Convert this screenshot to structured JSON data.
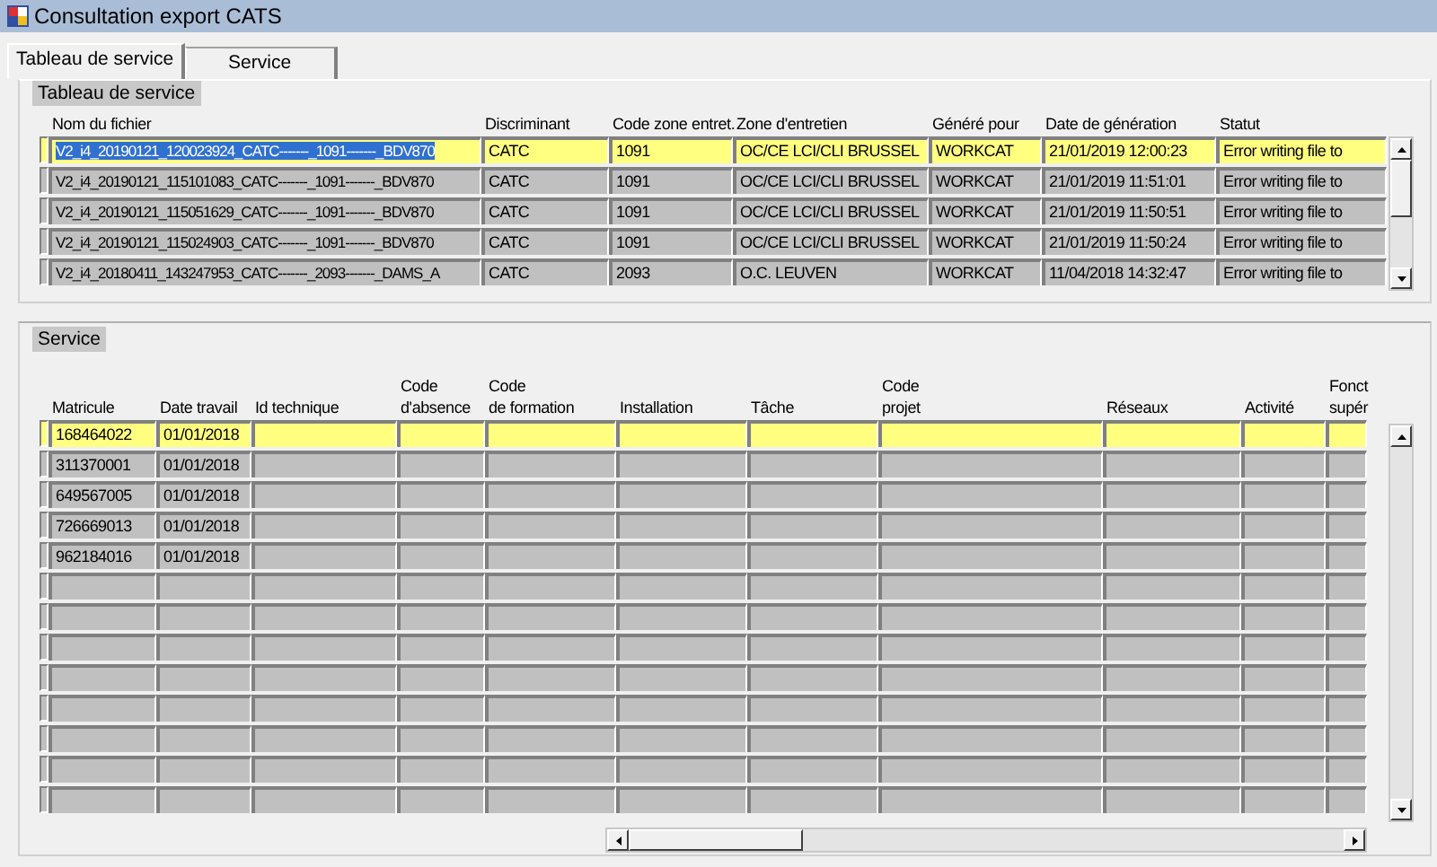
{
  "window": {
    "title": "Consultation export CATS"
  },
  "tabs": [
    {
      "label": "Tableau de service",
      "selected": true
    },
    {
      "label": "Service",
      "selected": false
    }
  ],
  "exports": {
    "title": "Tableau de service",
    "columns": [
      "Nom du fichier",
      "Discriminant",
      "Code zone entret.",
      "Zone d'entretien",
      "Généré pour",
      "Date de génération",
      "Statut"
    ],
    "rows": [
      {
        "selected": true,
        "cells": [
          "V2_i4_20190121_120023924_CATC-------_1091-------_BDV870",
          "CATC",
          "1091",
          "OC/CE LCI/CLI BRUSSEL",
          "WORKCAT",
          "21/01/2019 12:00:23",
          "Error writing file to"
        ]
      },
      {
        "selected": false,
        "cells": [
          "V2_i4_20190121_115101083_CATC-------_1091-------_BDV870",
          "CATC",
          "1091",
          "OC/CE LCI/CLI BRUSSEL",
          "WORKCAT",
          "21/01/2019 11:51:01",
          "Error writing file to"
        ]
      },
      {
        "selected": false,
        "cells": [
          "V2_i4_20190121_115051629_CATC-------_1091-------_BDV870",
          "CATC",
          "1091",
          "OC/CE LCI/CLI BRUSSEL",
          "WORKCAT",
          "21/01/2019 11:50:51",
          "Error writing file to"
        ]
      },
      {
        "selected": false,
        "cells": [
          "V2_i4_20190121_115024903_CATC-------_1091-------_BDV870",
          "CATC",
          "1091",
          "OC/CE LCI/CLI BRUSSEL",
          "WORKCAT",
          "21/01/2019 11:50:24",
          "Error writing file to"
        ]
      },
      {
        "selected": false,
        "cells": [
          "V2_i4_20180411_143247953_CATC-------_2093-------_DAMS_A",
          "CATC",
          "2093",
          "O.C. LEUVEN",
          "WORKCAT",
          "11/04/2018 14:32:47",
          "Error writing file to"
        ]
      }
    ]
  },
  "service": {
    "title": "Service",
    "columns": [
      "Matricule",
      "Date travail",
      "Id technique",
      "Code\nd'absence",
      "Code\nde formation",
      "Installation",
      "Tâche",
      "Code\nprojet",
      "Réseaux",
      "Activité",
      "Fonct\nsupér"
    ],
    "rows": [
      {
        "selected": true,
        "cells": [
          "168464022",
          "01/01/2018"
        ]
      },
      {
        "selected": false,
        "cells": [
          "311370001",
          "01/01/2018"
        ]
      },
      {
        "selected": false,
        "cells": [
          "649567005",
          "01/01/2018"
        ]
      },
      {
        "selected": false,
        "cells": [
          "726669013",
          "01/01/2018"
        ]
      },
      {
        "selected": false,
        "cells": [
          "962184016",
          "01/01/2018"
        ]
      },
      {
        "selected": false
      },
      {
        "selected": false
      },
      {
        "selected": false
      },
      {
        "selected": false
      },
      {
        "selected": false
      },
      {
        "selected": false
      },
      {
        "selected": false
      },
      {
        "selected": false
      }
    ]
  }
}
